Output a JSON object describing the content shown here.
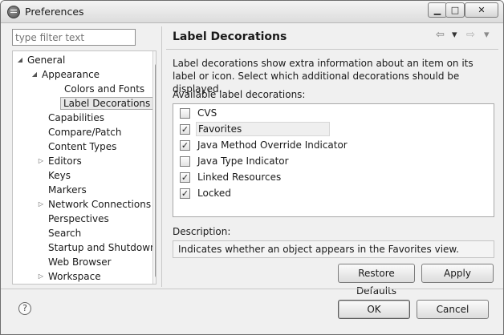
{
  "window": {
    "title": "Preferences",
    "minimize_symbol": "▁",
    "maximize_symbol": "□",
    "close_symbol": "✕"
  },
  "filter": {
    "placeholder": "type filter text",
    "value": ""
  },
  "tree": {
    "items": [
      {
        "label": "General",
        "level": 0,
        "expanded": true
      },
      {
        "label": "Appearance",
        "level": 1,
        "expanded": true
      },
      {
        "label": "Colors and Fonts",
        "level": 2
      },
      {
        "label": "Label Decorations",
        "level": 2,
        "selected": true
      },
      {
        "label": "Capabilities",
        "level": 1
      },
      {
        "label": "Compare/Patch",
        "level": 1
      },
      {
        "label": "Content Types",
        "level": 1
      },
      {
        "label": "Editors",
        "level": 1,
        "expanded": false
      },
      {
        "label": "Keys",
        "level": 1
      },
      {
        "label": "Markers",
        "level": 1
      },
      {
        "label": "Network Connections",
        "level": 1,
        "expanded": false
      },
      {
        "label": "Perspectives",
        "level": 1
      },
      {
        "label": "Search",
        "level": 1
      },
      {
        "label": "Startup and Shutdown",
        "level": 1
      },
      {
        "label": "Web Browser",
        "level": 1
      },
      {
        "label": "Workspace",
        "level": 1,
        "expanded": false
      }
    ]
  },
  "page": {
    "title": "Label Decorations",
    "description": "Label decorations show extra information about an item on its label or icon. Select which additional decorations should be displayed.",
    "available_label": "Available label decorations:",
    "decorations": [
      {
        "label": "CVS",
        "checked": false
      },
      {
        "label": "Favorites",
        "checked": true
      },
      {
        "label": "Java Method Override Indicator",
        "checked": true
      },
      {
        "label": "Java Type Indicator",
        "checked": false
      },
      {
        "label": "Linked Resources",
        "checked": true
      },
      {
        "label": "Locked",
        "checked": true
      }
    ],
    "description_label": "Description:",
    "description_value": "Indicates whether an object appears in the Favorites view.",
    "restore_defaults": "Restore Defaults",
    "apply": "Apply"
  },
  "dialog": {
    "ok": "OK",
    "cancel": "Cancel",
    "help_symbol": "?"
  },
  "icons": {
    "back": "⇦",
    "forward": "⇨",
    "menu_down": "▾",
    "expanded": "◢",
    "collapsed": "▷",
    "check": "✓",
    "scroll_up": "▲",
    "scroll_down": "▼"
  }
}
